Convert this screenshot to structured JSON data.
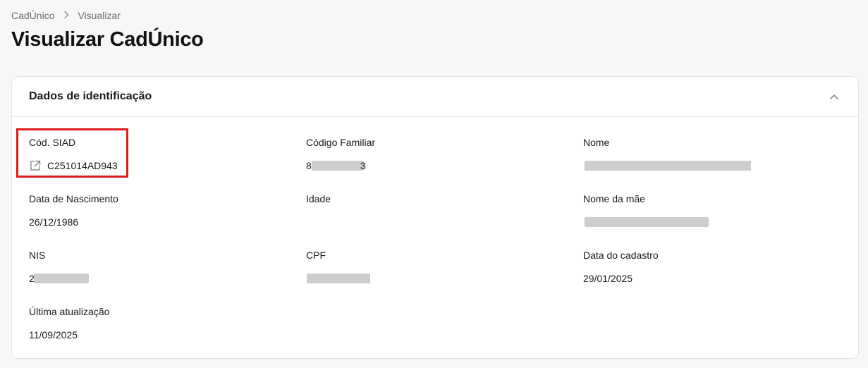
{
  "breadcrumb": {
    "root": "CadÚnico",
    "current": "Visualizar"
  },
  "page_title": "Visualizar CadÚnico",
  "section": {
    "title": "Dados de identificação",
    "fields": {
      "cod_siad": {
        "label": "Cód. SIAD",
        "value": "C251014AD943"
      },
      "codigo_familiar": {
        "label": "Código Familiar",
        "value": "8"
      },
      "nome": {
        "label": "Nome",
        "value": ""
      },
      "data_nascimento": {
        "label": "Data de Nascimento",
        "value": "26/12/1986"
      },
      "idade": {
        "label": "Idade",
        "value": ""
      },
      "nome_mae": {
        "label": "Nome da mãe",
        "value": ""
      },
      "nis": {
        "label": "NIS",
        "value": "2"
      },
      "cpf": {
        "label": "CPF",
        "value": ""
      },
      "data_cadastro": {
        "label": "Data do cadastro",
        "value": "29/01/2025"
      },
      "ultima_atualizacao": {
        "label": "Última atualização",
        "value": "11/09/2025"
      }
    }
  },
  "icons": {
    "breadcrumb_separator": "chevron-right-icon",
    "collapse": "chevron-up-icon",
    "external_link": "external-link-icon"
  },
  "colors": {
    "highlight": "#e01b1b",
    "redaction": "#cdcdcd"
  }
}
